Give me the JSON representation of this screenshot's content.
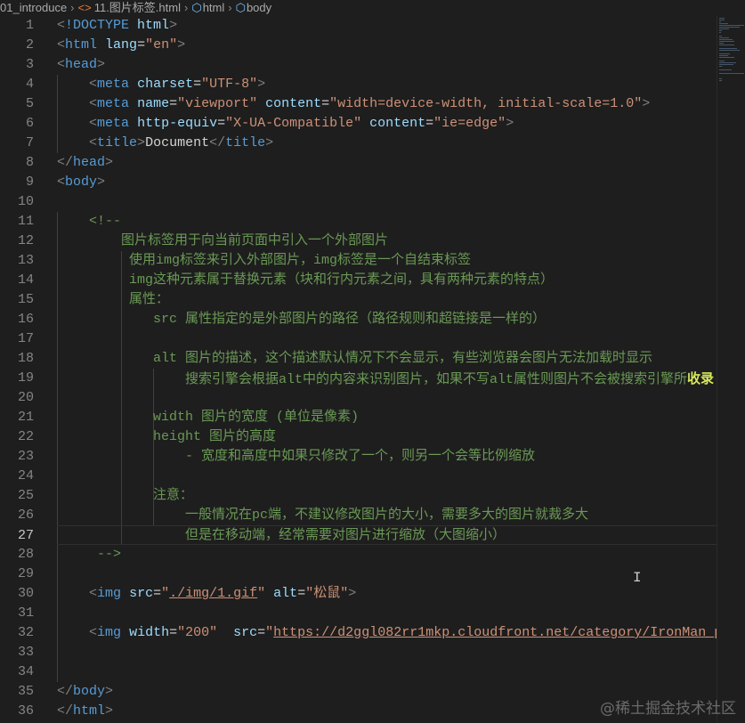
{
  "breadcrumb": {
    "folder": "01_introduce",
    "file": "11.图片标签.html",
    "items": [
      "html",
      "body"
    ],
    "file_icon": "html-file-icon",
    "item_icon": "symbol-box-icon"
  },
  "editor": {
    "current_line": 27,
    "lines": [
      [
        [
          "b",
          "<"
        ],
        [
          "tag",
          "!DOCTYPE"
        ],
        [
          "txt",
          " "
        ],
        [
          "attr",
          "html"
        ],
        [
          "b",
          ">"
        ]
      ],
      [
        [
          "b",
          "<"
        ],
        [
          "tag",
          "html"
        ],
        [
          "txt",
          " "
        ],
        [
          "attr",
          "lang"
        ],
        [
          "txt",
          "="
        ],
        [
          "str",
          "\"en\""
        ],
        [
          "b",
          ">"
        ]
      ],
      [
        [
          "b",
          "<"
        ],
        [
          "tag",
          "head"
        ],
        [
          "b",
          ">"
        ]
      ],
      [
        [
          "txt",
          "    "
        ],
        [
          "b",
          "<"
        ],
        [
          "tag",
          "meta"
        ],
        [
          "txt",
          " "
        ],
        [
          "attr",
          "charset"
        ],
        [
          "txt",
          "="
        ],
        [
          "str",
          "\"UTF-8\""
        ],
        [
          "b",
          ">"
        ]
      ],
      [
        [
          "txt",
          "    "
        ],
        [
          "b",
          "<"
        ],
        [
          "tag",
          "meta"
        ],
        [
          "txt",
          " "
        ],
        [
          "attr",
          "name"
        ],
        [
          "txt",
          "="
        ],
        [
          "str",
          "\"viewport\""
        ],
        [
          "txt",
          " "
        ],
        [
          "attr",
          "content"
        ],
        [
          "txt",
          "="
        ],
        [
          "str",
          "\"width=device-width, initial-scale=1.0\""
        ],
        [
          "b",
          ">"
        ]
      ],
      [
        [
          "txt",
          "    "
        ],
        [
          "b",
          "<"
        ],
        [
          "tag",
          "meta"
        ],
        [
          "txt",
          " "
        ],
        [
          "attr",
          "http-equiv"
        ],
        [
          "txt",
          "="
        ],
        [
          "str",
          "\"X-UA-Compatible\""
        ],
        [
          "txt",
          " "
        ],
        [
          "attr",
          "content"
        ],
        [
          "txt",
          "="
        ],
        [
          "str",
          "\"ie=edge\""
        ],
        [
          "b",
          ">"
        ]
      ],
      [
        [
          "txt",
          "    "
        ],
        [
          "b",
          "<"
        ],
        [
          "tag",
          "title"
        ],
        [
          "b",
          ">"
        ],
        [
          "txt",
          "Document"
        ],
        [
          "b",
          "</"
        ],
        [
          "tag",
          "title"
        ],
        [
          "b",
          ">"
        ]
      ],
      [
        [
          "b",
          "</"
        ],
        [
          "tag",
          "head"
        ],
        [
          "b",
          ">"
        ]
      ],
      [
        [
          "b",
          "<"
        ],
        [
          "tag",
          "body"
        ],
        [
          "b",
          ">"
        ]
      ],
      [],
      [
        [
          "com",
          "    <!--"
        ]
      ],
      [
        [
          "com",
          "        图片标签用于向当前页面中引入一个外部图片"
        ]
      ],
      [
        [
          "com",
          "         使用img标签来引入外部图片，img标签是一个自结束标签"
        ]
      ],
      [
        [
          "com",
          "         img这种元素属于替换元素（块和行内元素之间，具有两种元素的特点）"
        ]
      ],
      [
        [
          "com",
          "         属性："
        ]
      ],
      [
        [
          "com",
          "            src 属性指定的是外部图片的路径（路径规则和超链接是一样的）"
        ]
      ],
      [],
      [
        [
          "com",
          "            alt 图片的描述，这个描述默认情况下不会显示，有些浏览器会图片无法加载时显示"
        ]
      ],
      [
        [
          "com",
          "                搜索引擎会根据alt中的内容来识别图片，如果不写alt属性则图片不会被搜索引擎所"
        ],
        [
          "hl",
          "收录"
        ]
      ],
      [],
      [
        [
          "com",
          "            width 图片的宽度 (单位是像素)"
        ]
      ],
      [
        [
          "com",
          "            height 图片的高度"
        ]
      ],
      [
        [
          "com",
          "                - 宽度和高度中如果只修改了一个，则另一个会等比例缩放"
        ]
      ],
      [],
      [
        [
          "com",
          "            注意："
        ]
      ],
      [
        [
          "com",
          "                一般情况在pc端，不建议修改图片的大小，需要多大的图片就裁多大"
        ]
      ],
      [
        [
          "com",
          "                但是在移动端，经常需要对图片进行缩放（大图缩小）"
        ]
      ],
      [
        [
          "com",
          "     -->"
        ]
      ],
      [],
      [
        [
          "txt",
          "    "
        ],
        [
          "b",
          "<"
        ],
        [
          "tag",
          "img"
        ],
        [
          "txt",
          " "
        ],
        [
          "attr",
          "src"
        ],
        [
          "txt",
          "="
        ],
        [
          "str",
          "\""
        ],
        [
          "link",
          "./img/1.gif"
        ],
        [
          "str",
          "\""
        ],
        [
          "txt",
          " "
        ],
        [
          "attr",
          "alt"
        ],
        [
          "txt",
          "="
        ],
        [
          "str",
          "\"松鼠\""
        ],
        [
          "b",
          ">"
        ]
      ],
      [],
      [
        [
          "txt",
          "    "
        ],
        [
          "b",
          "<"
        ],
        [
          "tag",
          "img"
        ],
        [
          "txt",
          " "
        ],
        [
          "attr",
          "width"
        ],
        [
          "txt",
          "="
        ],
        [
          "str",
          "\"200\""
        ],
        [
          "txt",
          "  "
        ],
        [
          "attr",
          "src"
        ],
        [
          "txt",
          "="
        ],
        [
          "str",
          "\""
        ],
        [
          "link",
          "https://d2ggl082rr1mkp.cloudfront.net/category/IronMan_pr"
        ]
      ],
      [],
      [],
      [
        [
          "b",
          "</"
        ],
        [
          "tag",
          "body"
        ],
        [
          "b",
          ">"
        ]
      ],
      [
        [
          "b",
          "</"
        ],
        [
          "tag",
          "html"
        ],
        [
          "b",
          ">"
        ]
      ]
    ]
  },
  "watermark": "@稀土掘金技术社区",
  "colors": {
    "background": "#1e1e1e",
    "tag": "#569cd6",
    "attribute": "#9cdcfe",
    "string": "#ce9178",
    "comment": "#6a9955",
    "line_number": "#858585"
  }
}
